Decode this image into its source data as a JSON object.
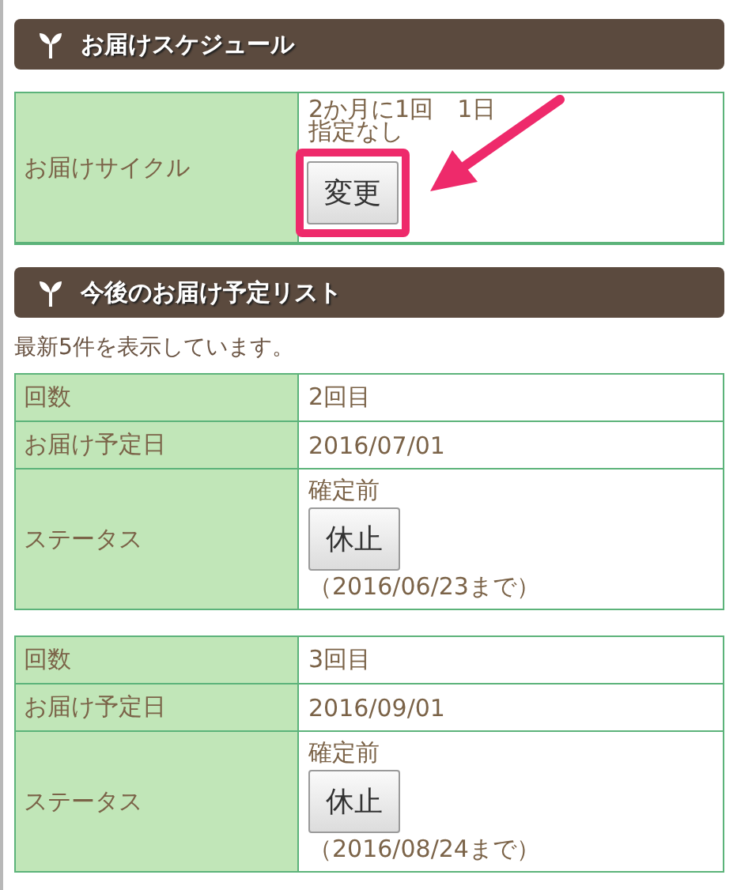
{
  "schedule": {
    "title": "お届けスケジュール",
    "rows": [
      {
        "label": "お届けサイクル",
        "lines": [
          "2か月に1回　1日",
          "指定なし"
        ],
        "button": {
          "label": "変更",
          "highlighted": true
        }
      }
    ]
  },
  "upcoming": {
    "title": "今後のお届け予定リスト",
    "note": "最新5件を表示しています。",
    "deliveries": [
      {
        "count_label": "回数",
        "count": "2回目",
        "date_label": "お届け予定日",
        "date": "2016/07/01",
        "status_label": "ステータス",
        "status": "確定前",
        "button": "休止",
        "deadline": "（2016/06/23まで）"
      },
      {
        "count_label": "回数",
        "count": "3回目",
        "date_label": "お届け予定日",
        "date": "2016/09/01",
        "status_label": "ステータス",
        "status": "確定前",
        "button": "休止",
        "deadline": "（2016/08/24まで）"
      }
    ]
  }
}
